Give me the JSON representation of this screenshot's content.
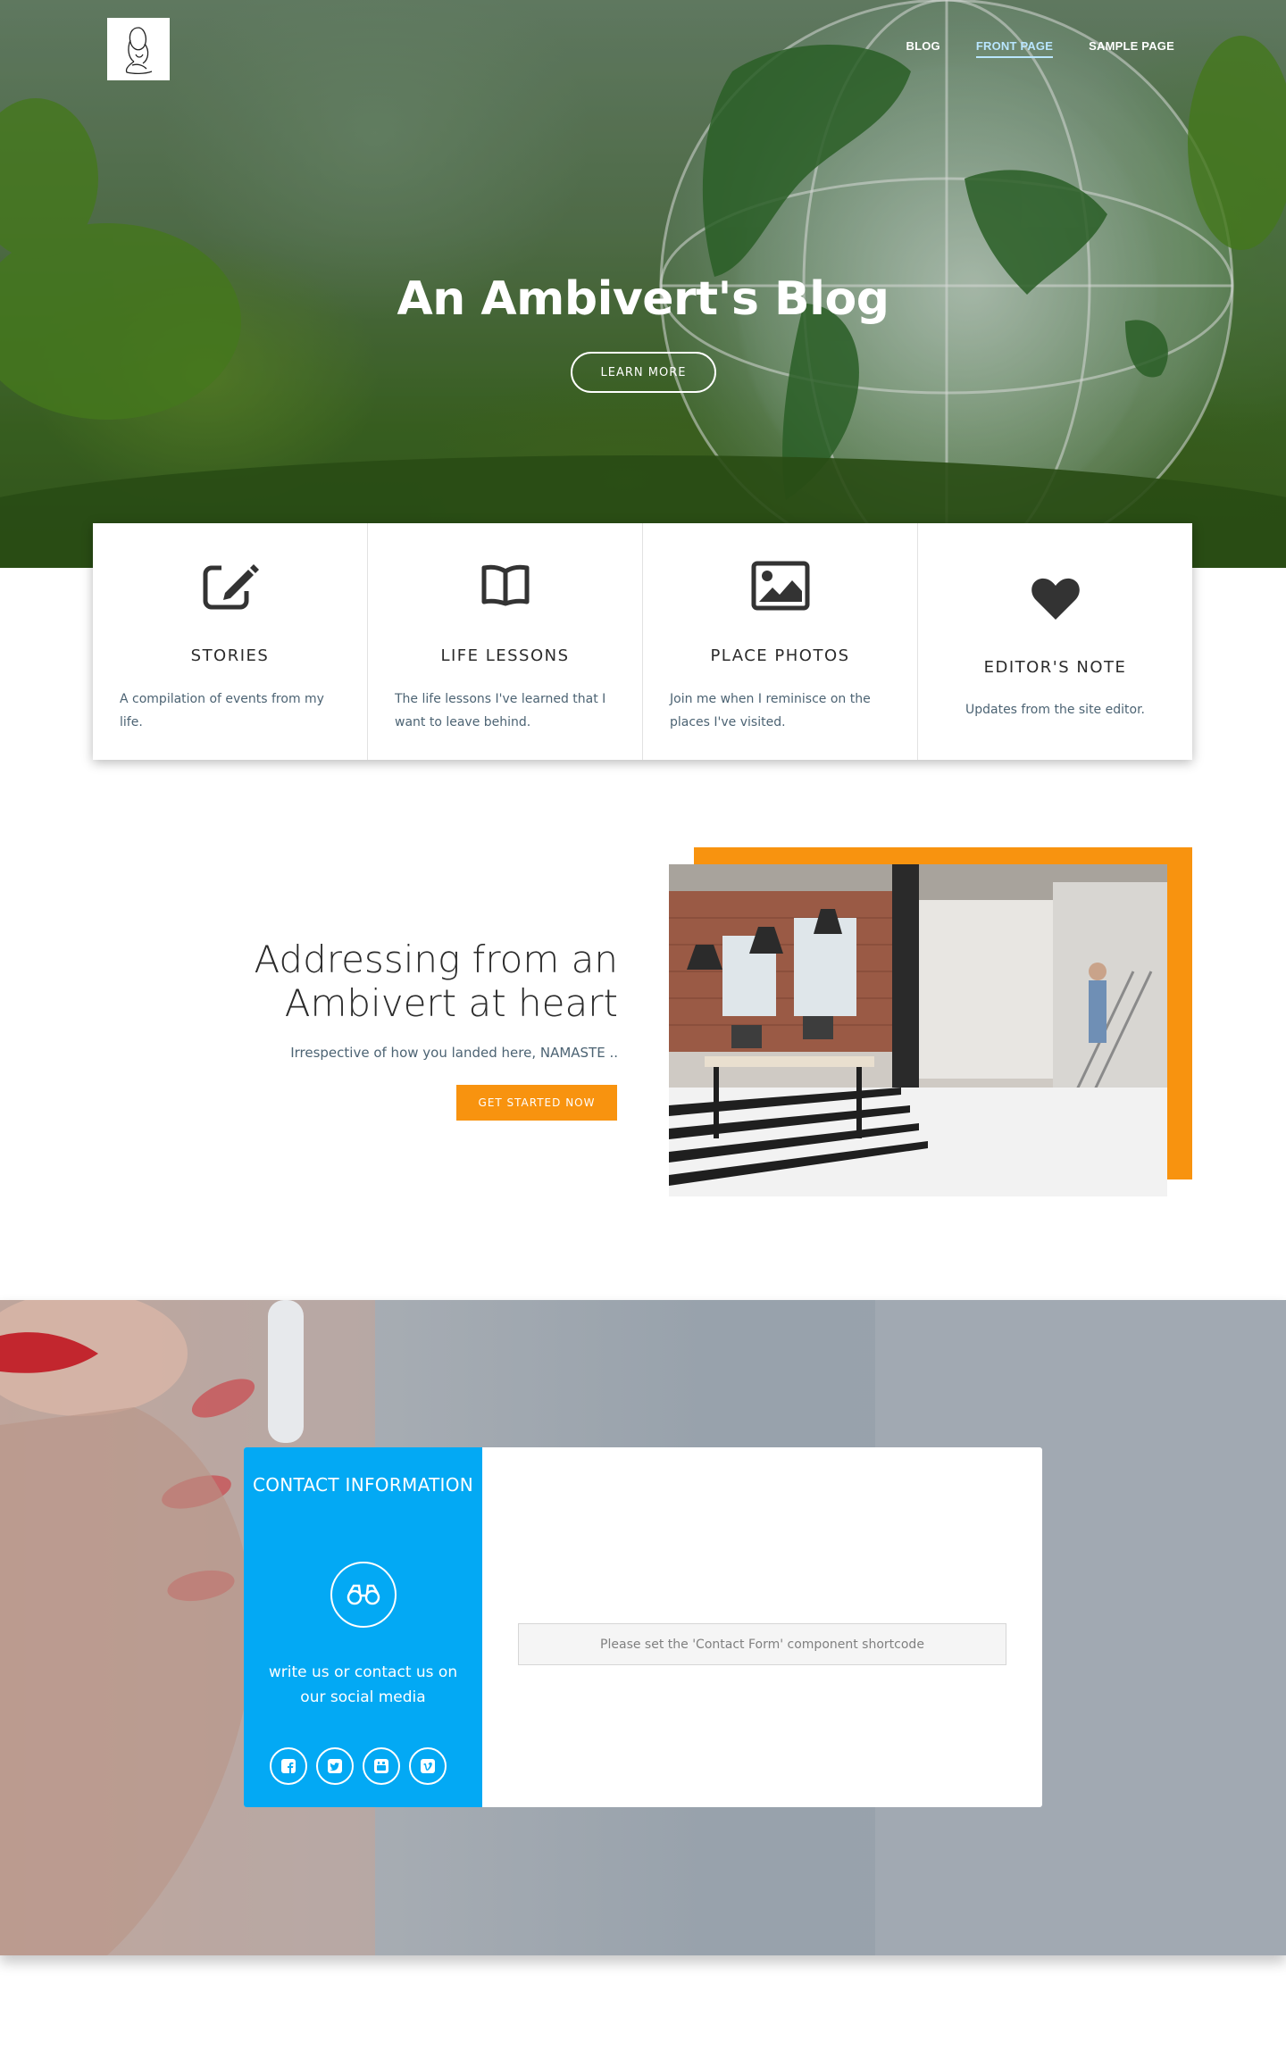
{
  "header": {
    "logo_alt": "site logo",
    "nav": [
      {
        "label": "BLOG",
        "active": false
      },
      {
        "label": "FRONT PAGE",
        "active": true
      },
      {
        "label": "SAMPLE PAGE",
        "active": false
      }
    ]
  },
  "hero": {
    "title": "An Ambivert's Blog",
    "button_label": "LEARN MORE"
  },
  "features": [
    {
      "icon": "edit-icon",
      "title": "STORIES",
      "description": "A compilation of events from my life."
    },
    {
      "icon": "book-icon",
      "title": "LIFE LESSONS",
      "description": "The life lessons I've learned that I want to leave behind."
    },
    {
      "icon": "image-icon",
      "title": "PLACE PHOTOS",
      "description": "Join me when I reminisce on the places I've visited."
    },
    {
      "icon": "heart-icon",
      "title": "EDITOR'S NOTE",
      "description": "Updates from the site editor."
    }
  ],
  "about": {
    "title": "Addressing from an Ambivert at heart",
    "subtitle": "Irrespective of how you landed here, NAMASTE   ..",
    "button_label": "GET STARTED NOW"
  },
  "contact": {
    "title": "CONTACT INFORMATION",
    "icon": "binoculars-icon",
    "text": "write us or contact us on our social media",
    "social": [
      "facebook-icon",
      "twitter-icon",
      "youtube-icon",
      "vimeo-icon"
    ],
    "form_placeholder": "Please set the 'Contact Form' component shortcode"
  },
  "colors": {
    "accent_blue": "#03a9f4",
    "accent_orange": "#f8930f",
    "nav_active": "#b9e6ff",
    "text_body": "#4c6373"
  }
}
